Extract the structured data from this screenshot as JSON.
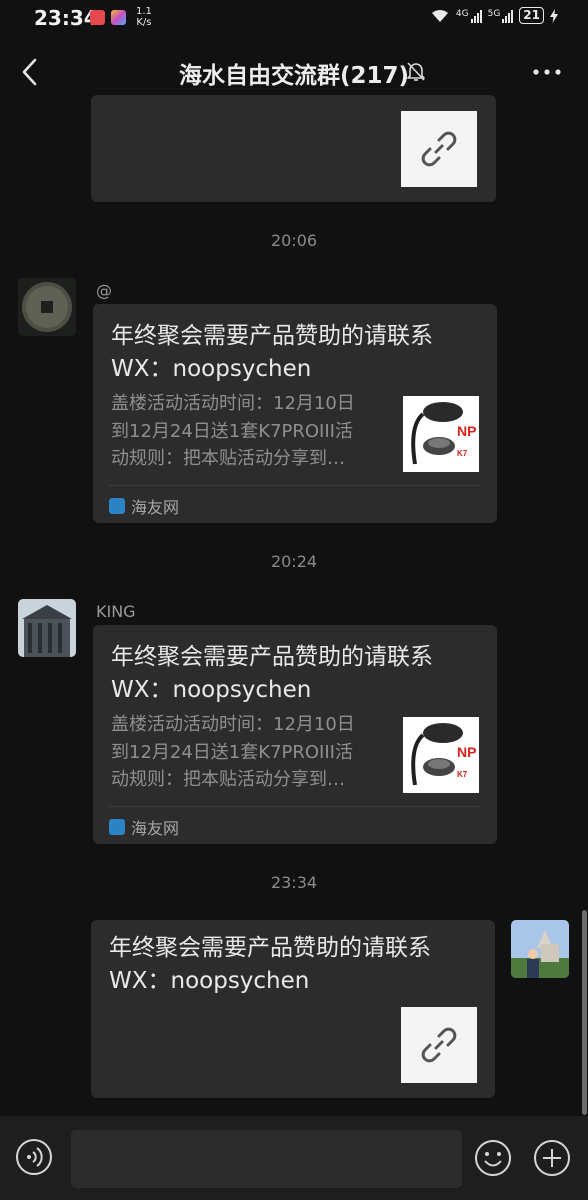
{
  "status_bar": {
    "time": "23:34",
    "net_speed_value": "1.1",
    "net_speed_unit": "K/s",
    "signal1_label": "4G",
    "signal2_label": "5G",
    "battery": "21"
  },
  "header": {
    "title": "海水自由交流群(217)"
  },
  "messages": {
    "top_link_card": {},
    "time1": "20:06",
    "msg1": {
      "sender": "@",
      "title": "年终聚会需要产品赞助的请联系WX：noopsychen",
      "title_line1": "年终聚会需要产品赞助的请联系",
      "title_line2": "WX：noopsychen",
      "desc_line1": "盖楼活动活动时间：12月10日",
      "desc_line2": "到12月24日送1套K7PROIII活",
      "desc_line3": "动规则：把本贴活动分享到…",
      "source": "海友网",
      "thumb_brand": "NP",
      "thumb_model": "K7"
    },
    "time2": "20:24",
    "msg2": {
      "sender": "KING",
      "title_line1": "年终聚会需要产品赞助的请联系",
      "title_line2": "WX：noopsychen",
      "desc_line1": "盖楼活动活动时间：12月10日",
      "desc_line2": "到12月24日送1套K7PROIII活",
      "desc_line3": "动规则：把本贴活动分享到…",
      "source": "海友网",
      "thumb_brand": "NP",
      "thumb_model": "K7"
    },
    "time3": "23:34",
    "msg3": {
      "title_line1": "年终聚会需要产品赞助的请联系",
      "title_line2": "WX：noopsychen"
    }
  },
  "colors": {
    "background": "#111111",
    "bubble": "#2c2c2c",
    "input_bar": "#1e1e1e",
    "text_primary": "#e9e9e9",
    "text_secondary": "#8f8f8f"
  },
  "icons": {
    "back": "chevron-left-icon",
    "mute": "bell-off-icon",
    "more": "more-dots-icon",
    "link": "link-icon",
    "voice": "voice-icon",
    "emoji": "emoji-icon",
    "plus": "plus-icon"
  }
}
